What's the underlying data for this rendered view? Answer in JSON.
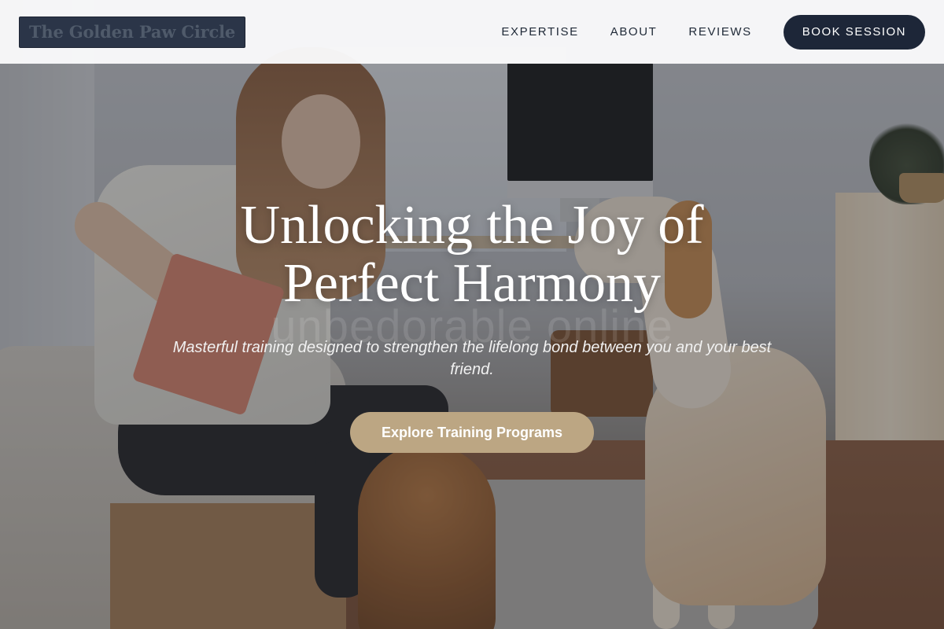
{
  "header": {
    "logo_text": "The Golden Paw Circle",
    "nav": [
      {
        "label": "EXPERTISE"
      },
      {
        "label": "ABOUT"
      },
      {
        "label": "REVIEWS"
      }
    ],
    "cta_label": "BOOK SESSION"
  },
  "hero": {
    "headline": "Unlocking the Joy of Perfect Harmony",
    "ghost_text": "unbedorable online",
    "subheading": "Masterful training designed to strengthen the lifelong bond between you and your best friend.",
    "cta_label": "Explore Training Programs",
    "image_description_icon": "hero-photo"
  },
  "colors": {
    "nav_dark": "#1d2638",
    "cta_tan": "#bca683",
    "logo_bg": "#2b3548"
  }
}
